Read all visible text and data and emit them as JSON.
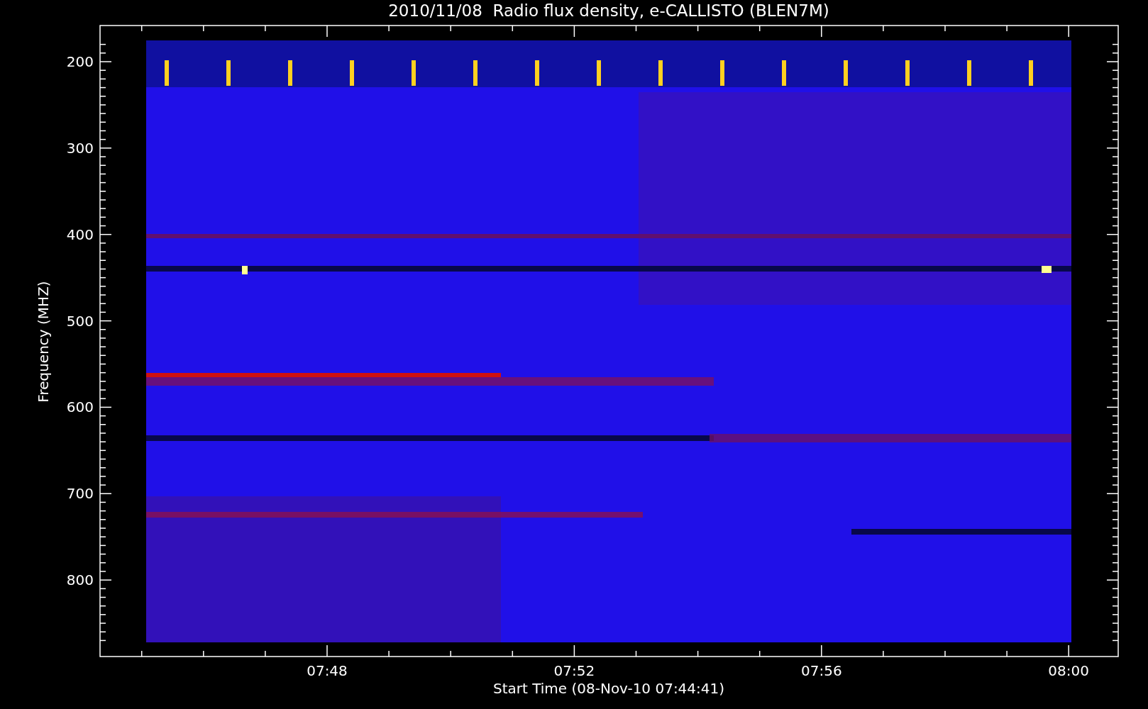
{
  "title": "2010/11/08  Radio flux density, e-CALLISTO (BLEN7M)",
  "y_axis": {
    "label": "Frequency (MHZ)",
    "ticks": [
      "200",
      "300",
      "400",
      "500",
      "600",
      "700",
      "800"
    ]
  },
  "x_axis": {
    "label": "Start Time (08-Nov-10 07:44:41)",
    "ticks": [
      "07:48",
      "07:52",
      "07:56",
      "08:00"
    ]
  }
}
